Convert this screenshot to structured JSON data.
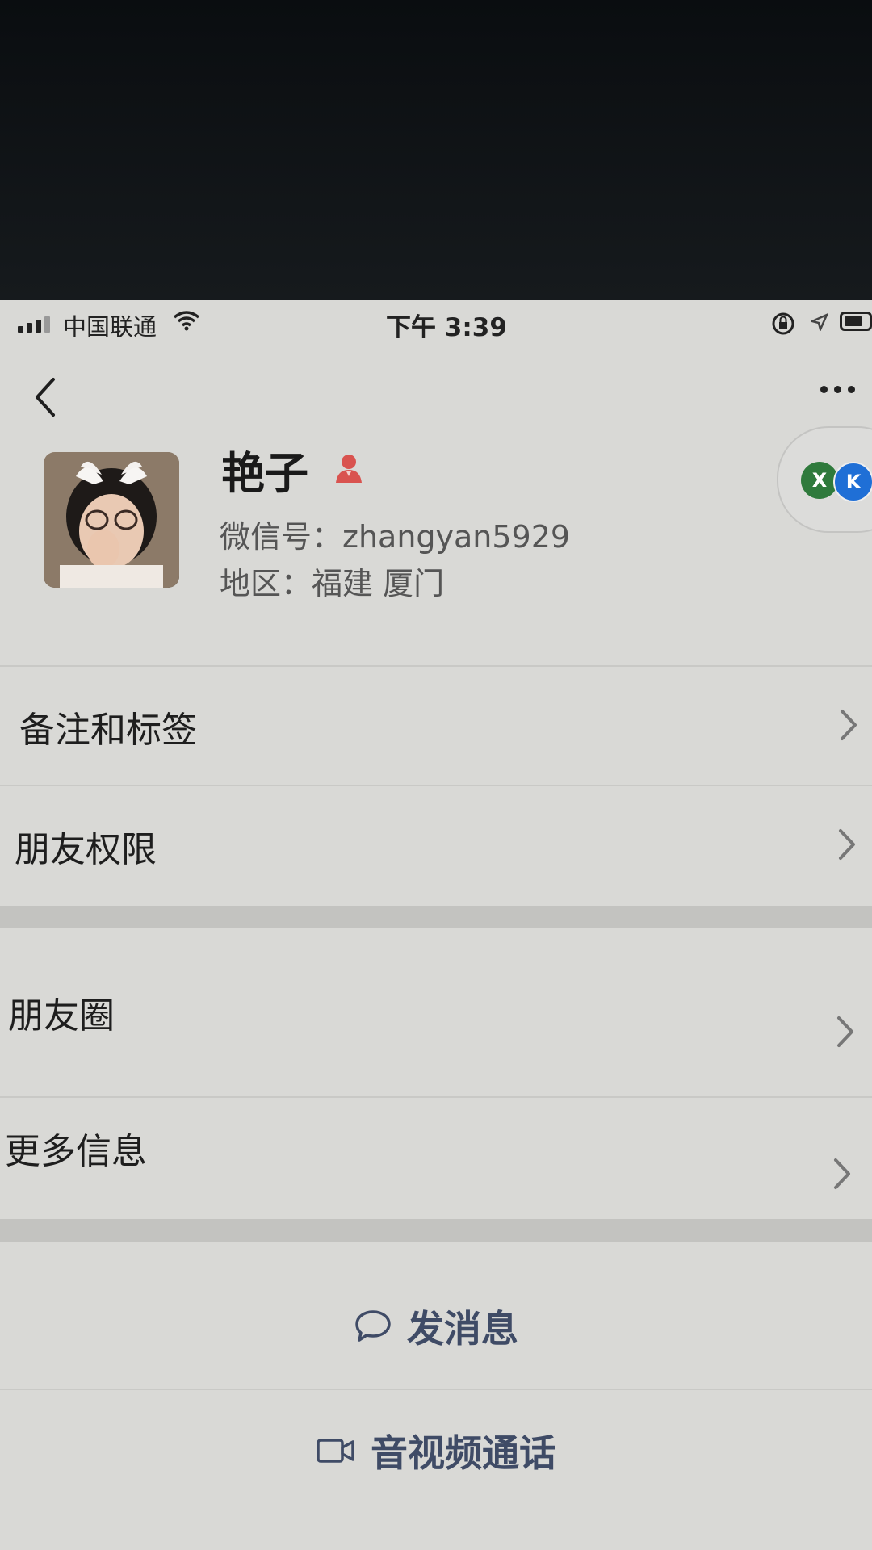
{
  "status_bar": {
    "carrier": "中国联通",
    "time": "下午 3:39"
  },
  "profile": {
    "name": "艳子",
    "wechat_id": "微信号：zhangyan5929",
    "region": "地区：福建 厦门"
  },
  "mini_programs": [
    "X",
    "K"
  ],
  "menu": {
    "remark_tags": "备注和标签",
    "friend_permissions": "朋友权限",
    "moments": "朋友圈",
    "more_info": "更多信息"
  },
  "actions": {
    "send_message": "发消息",
    "av_call": "音视频通话"
  },
  "colors": {
    "accent": "#3f4b66",
    "gender": "#d9534f"
  },
  "icons": [
    "back-arrow",
    "more-dots",
    "female-gender",
    "chevron-right",
    "chat-bubble",
    "video-camera"
  ]
}
